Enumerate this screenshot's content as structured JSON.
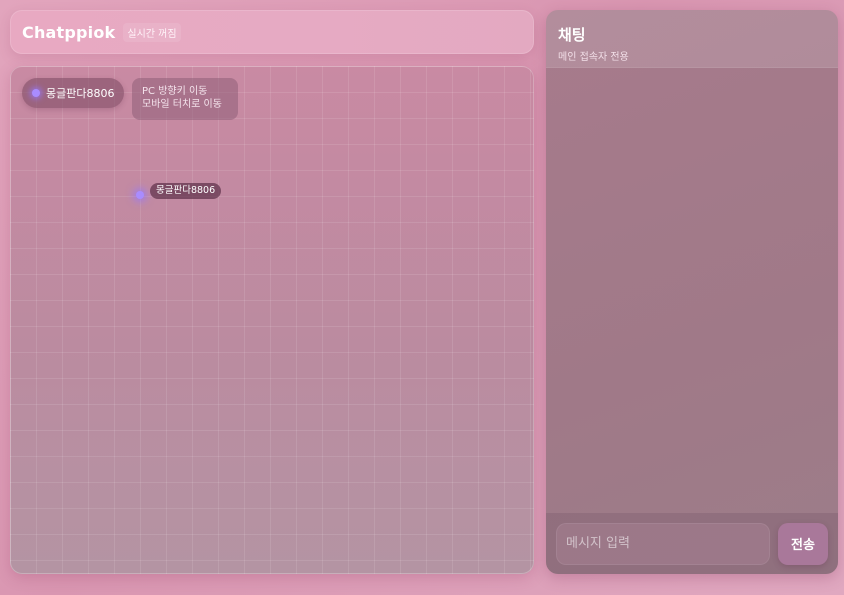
{
  "header": {
    "brand": "Chatppiok",
    "status": "실시간 꺼짐"
  },
  "board": {
    "player_pill": {
      "name": "몽글판다8806"
    },
    "help": {
      "line1": "PC 방향키 이동",
      "line2": "모바일 터치로 이동"
    },
    "avatar": {
      "name": "몽글판다8806",
      "dot_color": "#a98cff"
    }
  },
  "chat": {
    "title": "채팅",
    "subtitle": "메인 접속자 전용",
    "input_placeholder": "메시지 입력",
    "send_label": "전송"
  }
}
